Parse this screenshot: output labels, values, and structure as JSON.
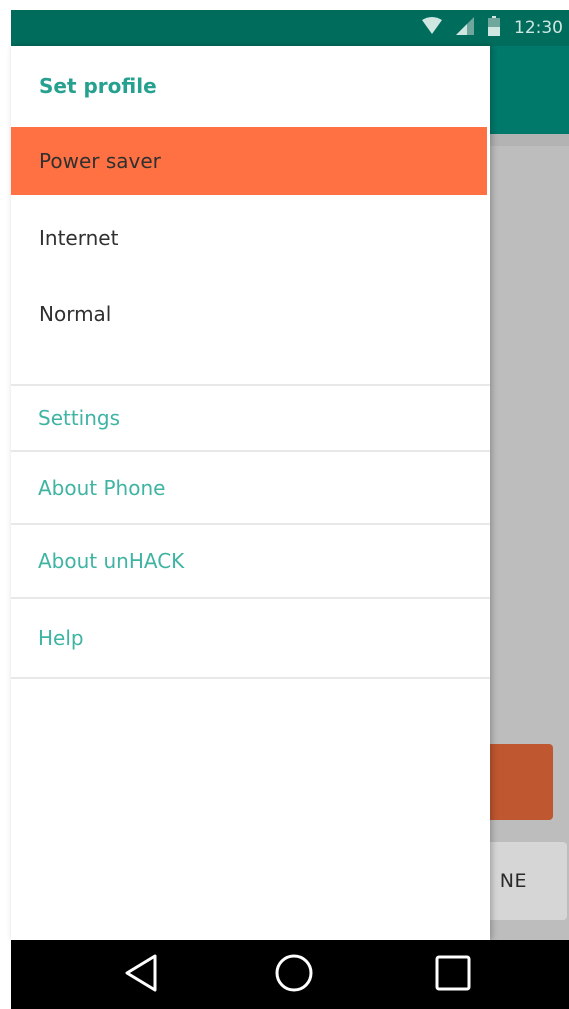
{
  "status_bar": {
    "time": "12:30",
    "icons": [
      "wifi-icon",
      "signal-icon",
      "battery-icon"
    ]
  },
  "drawer": {
    "header": "Set profile",
    "profiles": [
      {
        "label": "Power saver",
        "selected": true
      },
      {
        "label": "Internet",
        "selected": false
      },
      {
        "label": "Normal",
        "selected": false
      }
    ],
    "menu": [
      {
        "label": "Settings"
      },
      {
        "label": "About Phone"
      },
      {
        "label": "About unHACK"
      },
      {
        "label": "Help"
      }
    ]
  },
  "background_app": {
    "partial_button_text": "NE"
  },
  "system_nav": {
    "icons": [
      "back-icon",
      "home-icon",
      "recents-icon"
    ]
  },
  "colors": {
    "status_bar": "#006d5c",
    "toolbar": "#00796b",
    "accent": "#26a08f",
    "selected_item": "#ff7143",
    "menu_text": "#3fb4a3"
  }
}
